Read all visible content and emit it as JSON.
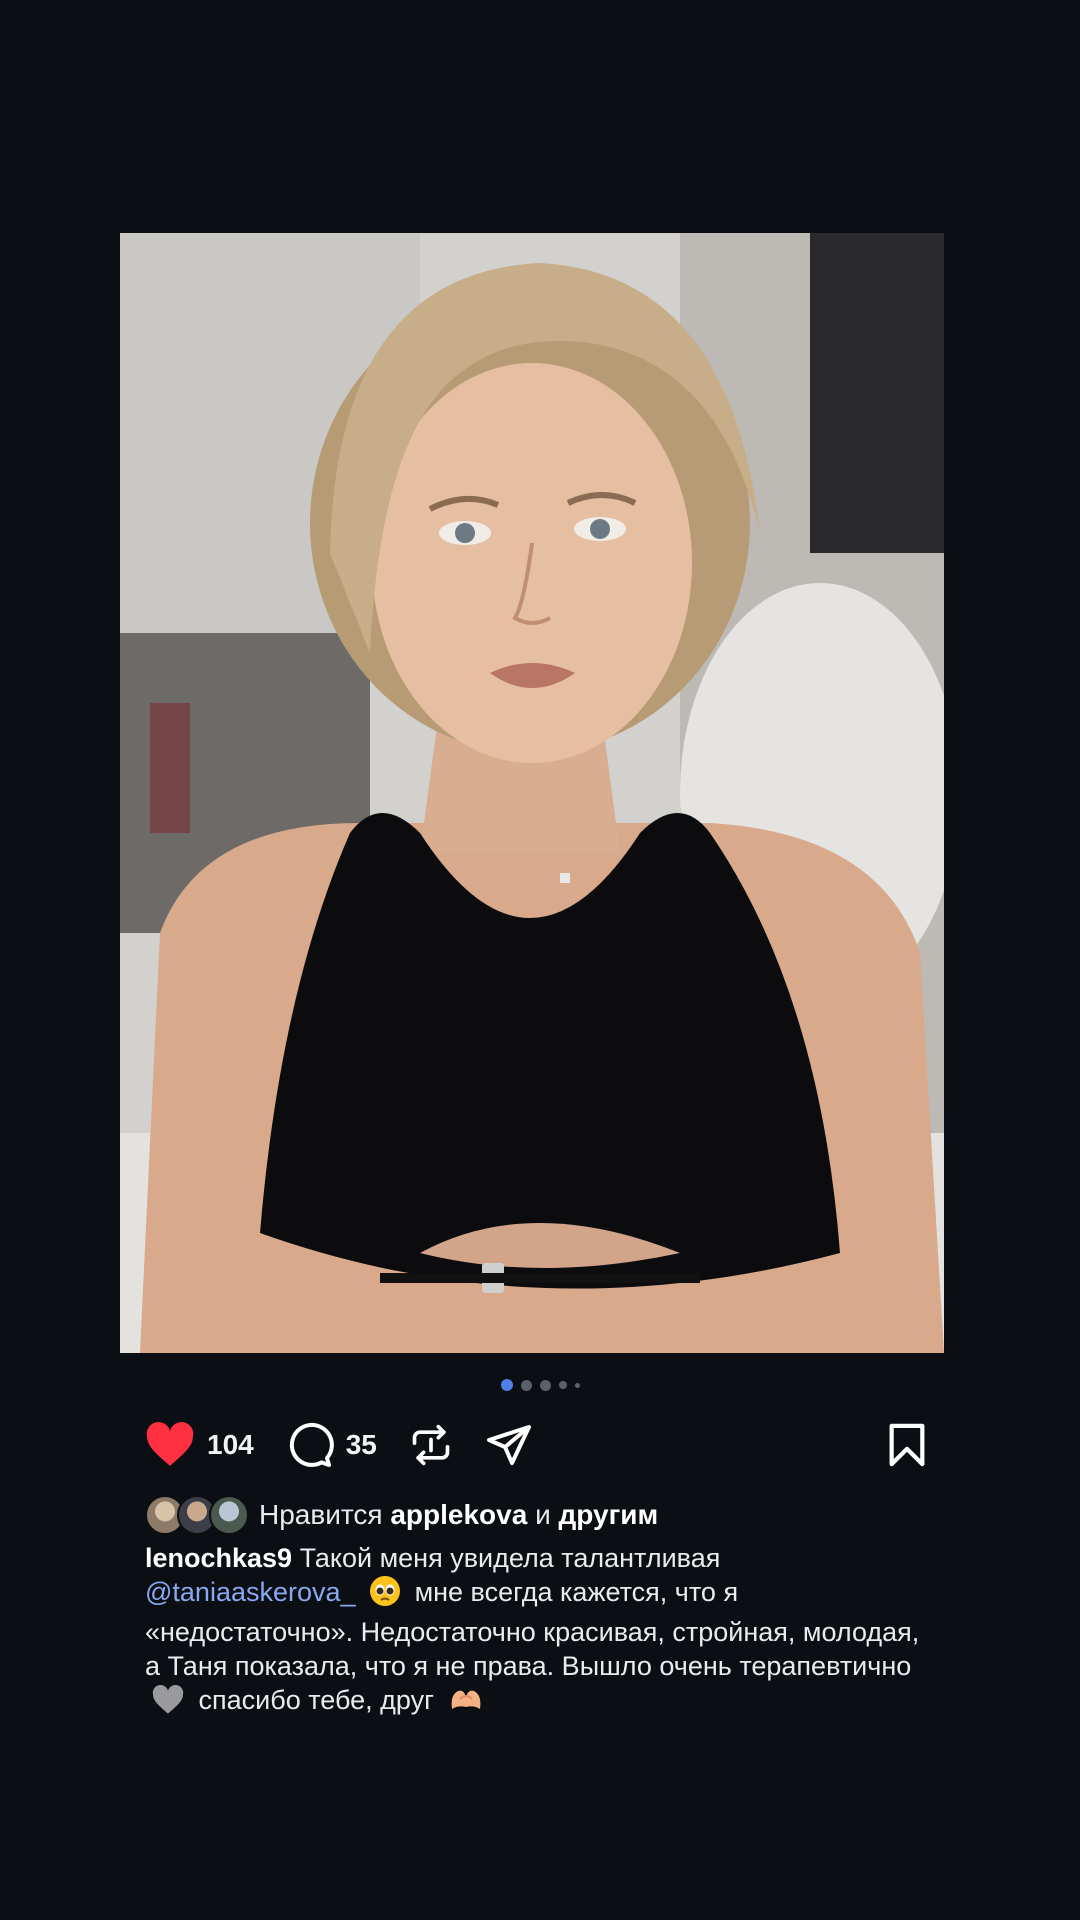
{
  "post": {
    "photo_alt": "portrait"
  },
  "carousel": {
    "count": 5,
    "active_index": 0
  },
  "actions": {
    "like_count": "104",
    "comment_count": "35",
    "liked": true
  },
  "likes": {
    "prefix": "Нравится",
    "user": "applekova",
    "joiner": "и",
    "others": "другим"
  },
  "caption": {
    "username": "lenochkas9",
    "text_1": "Такой меня увидела талантливая",
    "mention": "@taniaaskerova_",
    "text_2": "мне всегда кажется, что я «недостаточно». Недостаточно красивая, стройная, молодая, а Таня показала, что я не права. Вышло очень терапевтично",
    "text_3": "спасибо тебе, друг"
  },
  "colors": {
    "background": "#0b0e13",
    "like_red": "#ff3040",
    "mention_blue": "#8aa8f0",
    "dot_active": "#4f7fe8"
  },
  "icons": [
    "heart-icon",
    "comment-icon",
    "repost-icon",
    "share-icon",
    "bookmark-icon",
    "pleading-face-emoji",
    "grey-heart-emoji",
    "heart-hands-emoji"
  ]
}
